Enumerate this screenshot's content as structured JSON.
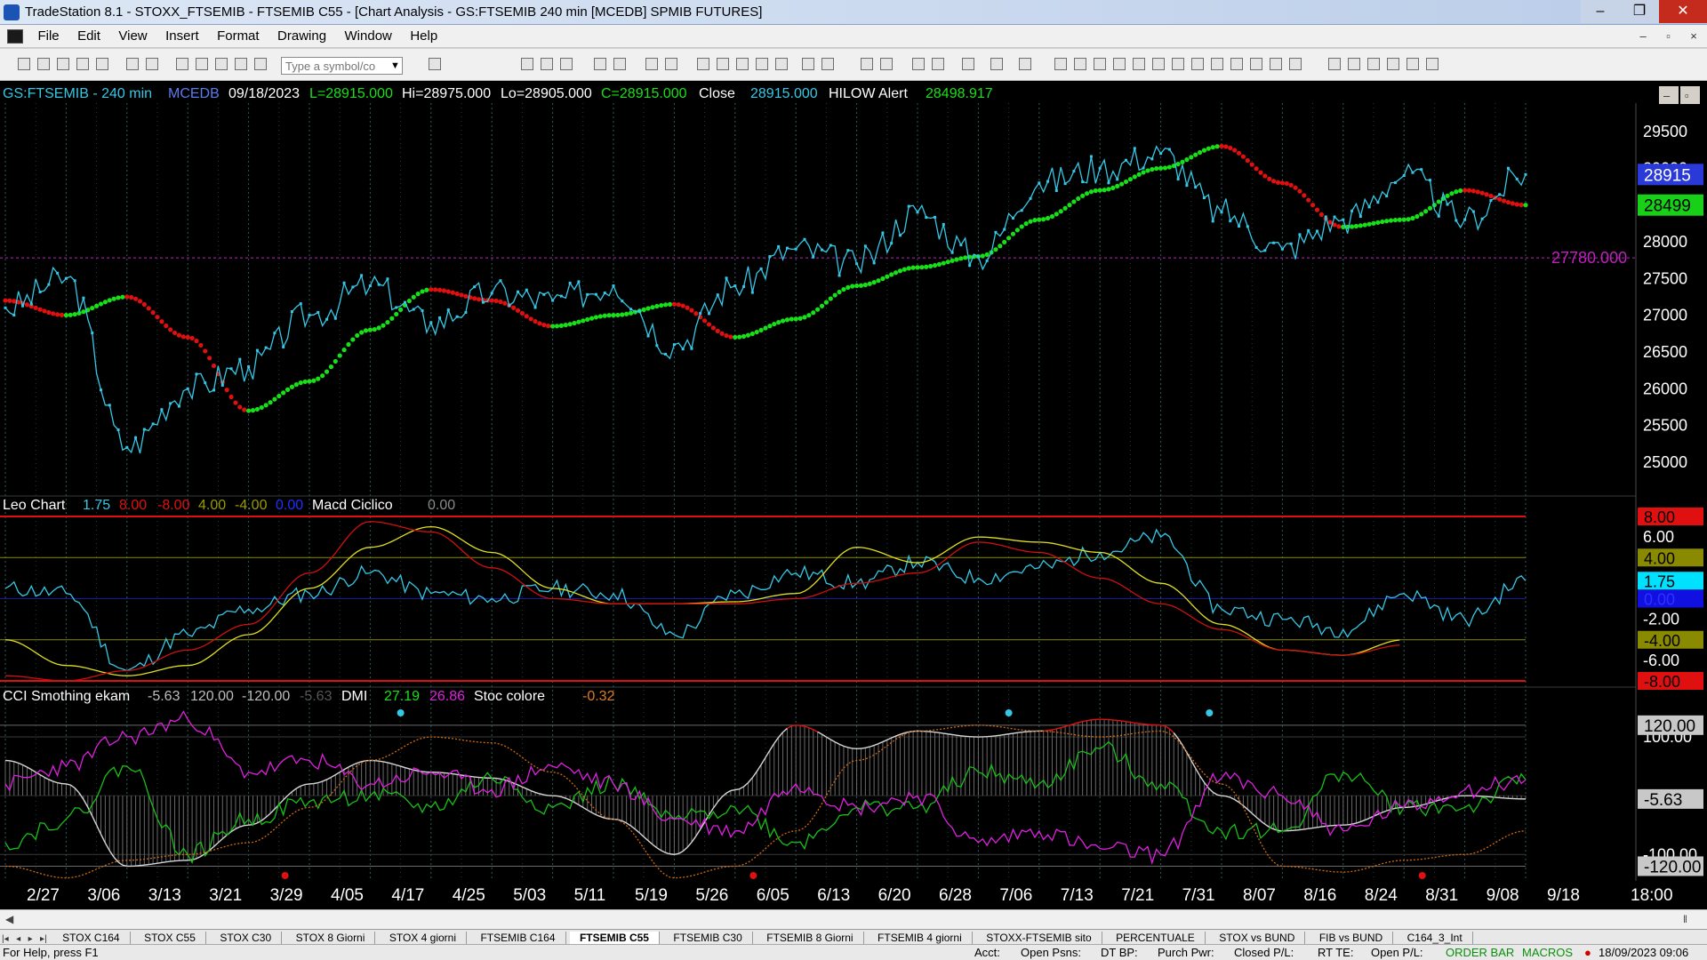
{
  "window": {
    "title": "TradeStation 8.1 - STOXX_FTSEMIB - FTSEMIB C55 - [Chart Analysis - GS:FTSEMIB  240 min  [MCEDB] SPMIB FUTURES]",
    "min": "‒",
    "max": "❐",
    "close": "✕"
  },
  "menu": [
    "File",
    "Edit",
    "View",
    "Insert",
    "Format",
    "Drawing",
    "Window",
    "Help"
  ],
  "mdi": {
    "min": "–",
    "restore": "▫",
    "close": "×"
  },
  "symbol_input": {
    "placeholder": "Type a symbol/co"
  },
  "price_panel": {
    "symbol": "GS:FTSEMIB - 240 min",
    "feed": "MCEDB",
    "date": "09/18/2023",
    "low_label": "L=28915.000",
    "high_label": "Hi=28975.000",
    "lo_label": "Lo=28905.000",
    "close_eq": "C=28915.000",
    "close_label": "Close",
    "close_value": "28915.000",
    "hilow_label": "HILOW Alert",
    "hilow_value": "28498.917",
    "y_ticks": [
      "29500",
      "29000",
      "28500",
      "28000",
      "27500",
      "27000",
      "26500",
      "26000",
      "25500",
      "25000"
    ],
    "markers": {
      "last": "28915",
      "hilow": "28499",
      "hline": "27780.000"
    },
    "colors": {
      "price": "#35c8e6",
      "hilow_up": "#18e018",
      "hilow_down": "#e01010",
      "hline": "#c020c0"
    }
  },
  "leo_panel": {
    "name": "Leo Chart",
    "v1": "1.75",
    "v2": "8.00",
    "v3": "-8.00",
    "v4": "4.00",
    "v5": "-4.00",
    "v6": "0.00",
    "macd_label": "Macd Ciclico",
    "macd_value": "0.00",
    "y_ticks": [
      "6.00",
      "-2.00",
      "-6.00"
    ],
    "axis_boxes": [
      {
        "label": "8.00",
        "value": 8,
        "bg": "#e01010",
        "fg": "#000000"
      },
      {
        "label": "4.00",
        "value": 4,
        "bg": "#8a8a00",
        "fg": "#000000"
      },
      {
        "label": "1.75",
        "value": 1.75,
        "bg": "#00e0ff",
        "fg": "#000000"
      },
      {
        "label": "0.00",
        "value": 0,
        "bg": "#1010e0",
        "fg": "#3030ff"
      },
      {
        "label": "-4.00",
        "value": -4,
        "bg": "#8a8a00",
        "fg": "#000000"
      },
      {
        "label": "-8.00",
        "value": -8,
        "bg": "#e01010",
        "fg": "#000000"
      }
    ]
  },
  "cci_panel": {
    "name": "CCI Smothing ekam",
    "v1": "-5.63",
    "v2": "120.00",
    "v3": "-120.00",
    "v4": "-5.63",
    "dmi_label": "DMI",
    "dmi_plus": "27.19",
    "dmi_minus": "26.86",
    "stoc_label": "Stoc colore",
    "stoc_value": "-0.32",
    "y_ticks": [
      "100.00",
      "-100.00"
    ],
    "axis_boxes": [
      {
        "label": "120.00",
        "value": 120,
        "bg": "#c8c8c8"
      },
      {
        "label": "-5.63",
        "value": -5.63,
        "bg": "#c8c8c8"
      },
      {
        "label": "-120.00",
        "value": -120,
        "bg": "#c8c8c8"
      }
    ]
  },
  "x_axis": [
    "2/27",
    "3/06",
    "3/13",
    "3/21",
    "3/29",
    "4/05",
    "4/17",
    "4/25",
    "5/03",
    "5/11",
    "5/19",
    "5/26",
    "6/05",
    "6/13",
    "6/20",
    "6/28",
    "7/06",
    "7/13",
    "7/21",
    "7/31",
    "8/07",
    "8/16",
    "8/24",
    "8/31",
    "9/08",
    "9/18",
    "18:00"
  ],
  "tabs": [
    "STOX C164",
    "STOX C55",
    "STOX C30",
    "STOX 8 Giorni",
    "STOX 4 giorni",
    "FTSEMIB C164",
    "FTSEMIB C55",
    "FTSEMIB C30",
    "FTSEMIB 8 Giorni",
    "FTSEMIB 4 giorni",
    "STOXX-FTSEMIB sito",
    "PERCENTUALE",
    "STOX vs BUND",
    "FIB vs BUND",
    "C164_3_Int"
  ],
  "active_tab": "FTSEMIB C55",
  "tab_nav": [
    "|◂",
    "◂",
    "▸",
    "▸|"
  ],
  "status": {
    "help": "For Help, press F1",
    "acct": "Acct:",
    "open_psns": "Open Psns:",
    "dt_bp": "DT BP:",
    "purch_pwr": "Purch Pwr:",
    "closed_pl": "Closed P/L:",
    "rt_te": "RT TE:",
    "open_pl": "Open P/L:",
    "order_bar": "ORDER BAR",
    "macros": "MACROS",
    "datetime": "18/09/2023 09:06"
  },
  "chart_data": [
    {
      "type": "line",
      "title": "GS:FTSEMIB - 240 min",
      "x": [
        "2/27",
        "3/06",
        "3/13",
        "3/21",
        "3/29",
        "4/05",
        "4/17",
        "4/25",
        "5/03",
        "5/11",
        "5/19",
        "5/26",
        "6/05",
        "6/13",
        "6/20",
        "6/28",
        "7/06",
        "7/13",
        "7/21",
        "7/31",
        "8/07",
        "8/16",
        "8/24",
        "8/31",
        "9/08",
        "9/18"
      ],
      "ylim": [
        24600,
        29850
      ],
      "series": [
        {
          "name": "Close",
          "values": [
            27100,
            27500,
            25200,
            26000,
            26300,
            27000,
            27400,
            26900,
            27300,
            27200,
            27400,
            26600,
            27400,
            27900,
            27700,
            28400,
            27800,
            28800,
            29000,
            29200,
            28400,
            27900,
            28300,
            28900,
            28300,
            28915
          ]
        },
        {
          "name": "HILOW Alert",
          "values": [
            27200,
            27000,
            27250,
            26700,
            25700,
            26100,
            26800,
            27350,
            27200,
            26850,
            27000,
            27150,
            26700,
            26950,
            27400,
            27650,
            27800,
            28300,
            28700,
            29000,
            29300,
            28800,
            28200,
            28300,
            28700,
            28499
          ]
        }
      ]
    },
    {
      "type": "line",
      "title": "Leo Chart",
      "x": [
        "2/27",
        "3/06",
        "3/13",
        "3/21",
        "3/29",
        "4/05",
        "4/17",
        "4/25",
        "5/03",
        "5/11",
        "5/19",
        "5/26",
        "6/05",
        "6/13",
        "6/20",
        "6/28",
        "7/06",
        "7/13",
        "7/21",
        "7/31",
        "8/07",
        "8/16",
        "8/24",
        "8/31",
        "9/08",
        "9/18"
      ],
      "ylim": [
        -8,
        8
      ],
      "series": [
        {
          "name": "Leo Chart",
          "values": [
            1.0,
            0.5,
            -7.0,
            -3.5,
            -1.0,
            0.5,
            2.5,
            0.5,
            0.0,
            1.0,
            0.5,
            -3.5,
            0.5,
            2.5,
            1.5,
            3.5,
            2.0,
            3.0,
            4.5,
            6.0,
            -1.0,
            -2.0,
            -3.0,
            0.5,
            -2.0,
            1.75
          ]
        },
        {
          "name": "Macd Ciclico",
          "values": [
            -4.0,
            -6.5,
            -7.5,
            -6.5,
            -3.5,
            1.0,
            5.0,
            7.0,
            4.5,
            1.0,
            -0.5,
            -0.5,
            -0.3,
            0.5,
            5.0,
            3.5,
            6.0,
            5.5,
            4.5,
            1.5,
            -2.5,
            -5.0,
            -5.5,
            -4.0,
            null,
            null
          ]
        },
        {
          "name": "",
          "values": [
            -7.5,
            -8.0,
            -7.0,
            -5.0,
            -2.5,
            2.5,
            7.5,
            6.5,
            3.0,
            0.0,
            -0.5,
            -0.5,
            -0.5,
            0.0,
            1.5,
            2.5,
            5.5,
            4.5,
            2.0,
            -0.5,
            -3.0,
            -5.0,
            -5.5,
            -4.5,
            null,
            null
          ]
        }
      ]
    },
    {
      "type": "line",
      "title": "CCI Smothing ekam",
      "x": [
        "2/27",
        "3/06",
        "3/13",
        "3/21",
        "3/29",
        "4/05",
        "4/17",
        "4/25",
        "5/03",
        "5/11",
        "5/19",
        "5/26",
        "6/05",
        "6/13",
        "6/20",
        "6/28",
        "7/06",
        "7/13",
        "7/21",
        "7/31",
        "8/07",
        "8/16",
        "8/24",
        "8/31",
        "9/08",
        "9/18"
      ],
      "ylim": [
        -145,
        150
      ],
      "series": [
        {
          "name": "CCI Smothing ekam",
          "values": [
            60,
            20,
            -120,
            -110,
            -50,
            20,
            60,
            40,
            30,
            0,
            -40,
            -100,
            10,
            120,
            80,
            110,
            100,
            110,
            130,
            120,
            0,
            -60,
            -50,
            -20,
            0,
            -5.63
          ]
        },
        {
          "name": "DMI",
          "values": [
            -80,
            -40,
            50,
            -100,
            -40,
            -10,
            0,
            -20,
            30,
            -20,
            20,
            -40,
            -20,
            -80,
            -20,
            -20,
            40,
            20,
            80,
            20,
            -60,
            -60,
            40,
            -20,
            -20,
            27.19
          ]
        },
        {
          "name": "",
          "values": [
            20,
            50,
            100,
            130,
            40,
            60,
            20,
            40,
            10,
            50,
            20,
            -40,
            -60,
            20,
            -20,
            0,
            -80,
            -60,
            -90,
            -100,
            30,
            0,
            -60,
            -20,
            10,
            26.86
          ]
        },
        {
          "name": "Stoc colore",
          "values": [
            -120,
            -140,
            -110,
            -100,
            -80,
            -20,
            60,
            100,
            90,
            40,
            -40,
            -140,
            -120,
            -60,
            60,
            110,
            120,
            110,
            100,
            110,
            20,
            -120,
            -130,
            -110,
            -100,
            -60
          ]
        }
      ]
    }
  ]
}
